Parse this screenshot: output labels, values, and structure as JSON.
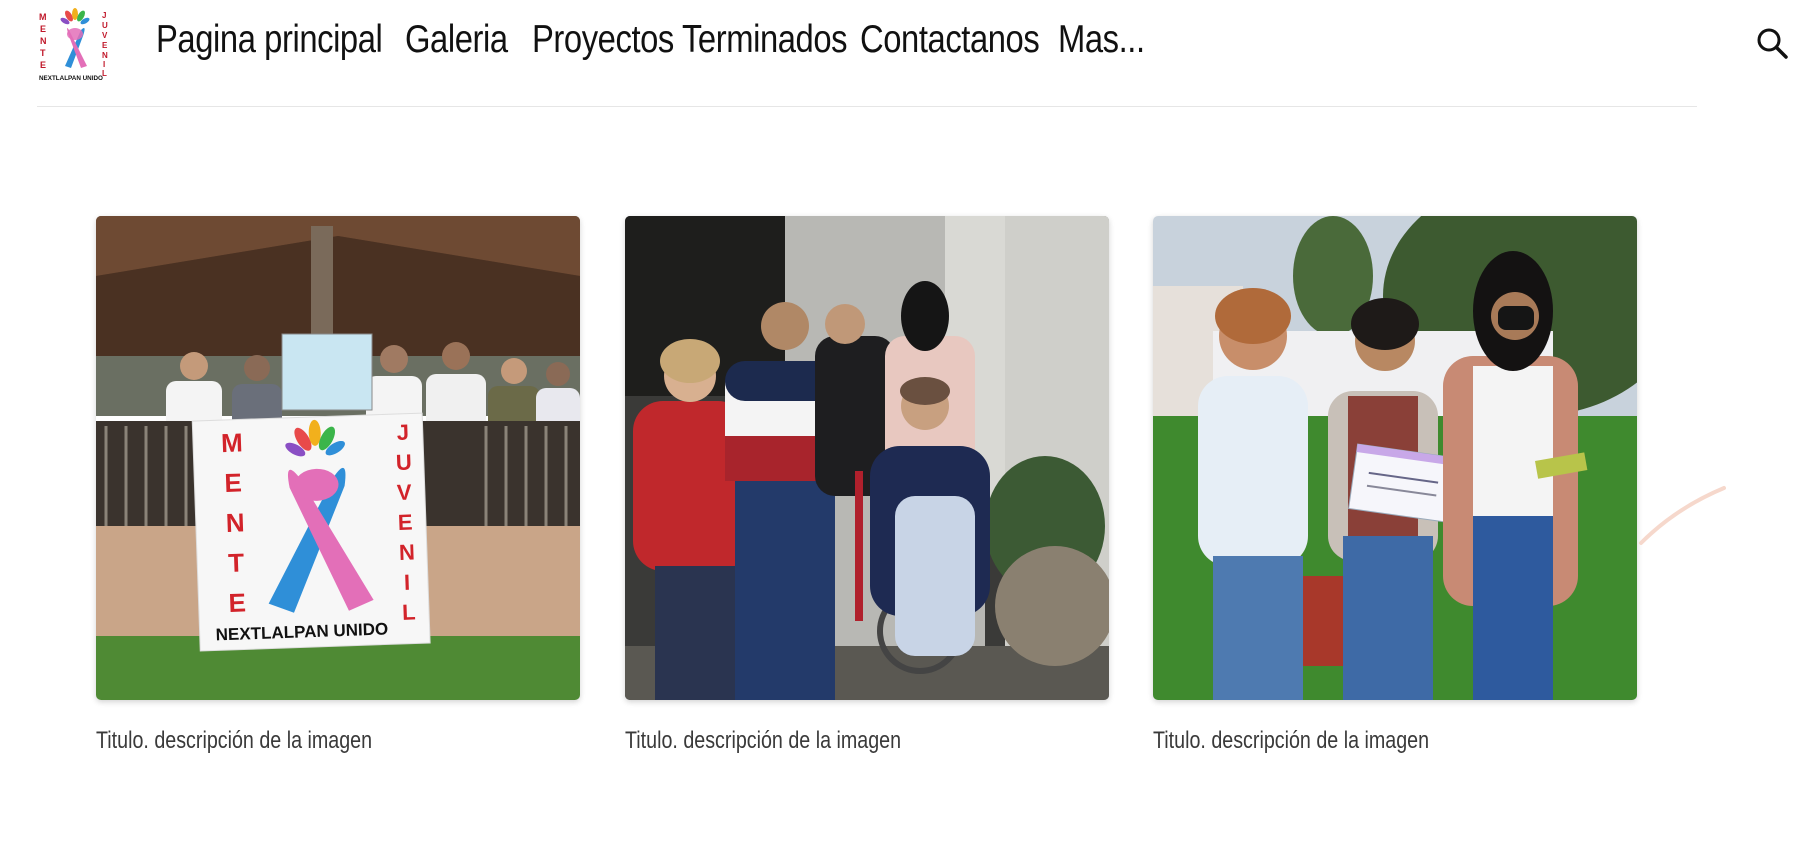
{
  "header": {
    "logo": {
      "left_text": "MENTE",
      "right_text": "JUVENIL",
      "bottom_text": "NEXTLALPAN UNIDO"
    },
    "nav": [
      {
        "label": "Pagina principal"
      },
      {
        "label": "Galeria"
      },
      {
        "label": "Proyectos Terminados"
      },
      {
        "label": "Contactanos"
      },
      {
        "label": "Mas..."
      }
    ],
    "search_icon": "search-icon"
  },
  "gallery": {
    "items": [
      {
        "caption": "Titulo. descripción de la imagen",
        "photo": "group-at-kiosk-with-banner",
        "banner": {
          "left": "MENTE",
          "right": "JUVENIL",
          "bottom": "NEXTLALPAN UNIDO"
        }
      },
      {
        "caption": "Titulo. descripción de la imagen",
        "photo": "group-with-woman-in-wheelchair"
      },
      {
        "caption": "Titulo. descripción de la imagen",
        "photo": "women-with-diploma-outdoors"
      }
    ]
  },
  "colors": {
    "ribbon_blue": "#2f8fd8",
    "ribbon_pink": "#e36fb8",
    "logo_red": "#c0182a",
    "divider": "#e6e6e6"
  }
}
